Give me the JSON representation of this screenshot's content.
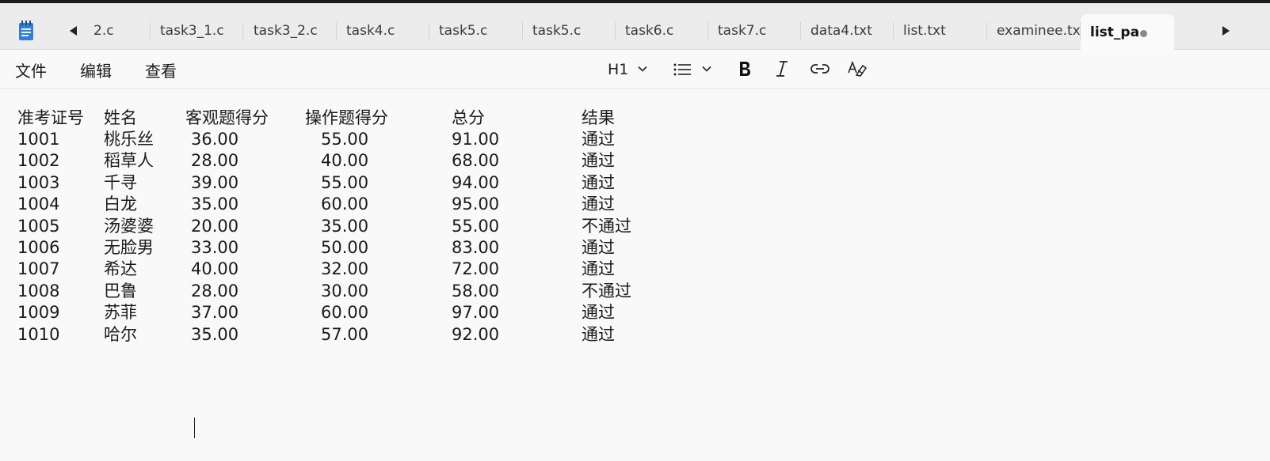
{
  "tabs": {
    "items": [
      {
        "label": "2.c"
      },
      {
        "label": "task3_1.c"
      },
      {
        "label": "task3_2.c"
      },
      {
        "label": "task4.c"
      },
      {
        "label": "task5.c"
      },
      {
        "label": "task5.c"
      },
      {
        "label": "task6.c"
      },
      {
        "label": "task7.c"
      },
      {
        "label": "data4.txt"
      },
      {
        "label": "list.txt"
      },
      {
        "label": "examinee.txt"
      },
      {
        "label": "list_pa"
      }
    ]
  },
  "menu": {
    "file": "文件",
    "edit": "编辑",
    "view": "查看"
  },
  "toolbar": {
    "heading_label": "H1"
  },
  "document": {
    "header": [
      "准考证号",
      "姓名",
      "客观题得分",
      "操作题得分",
      "总分",
      "结果"
    ],
    "rows": [
      [
        "1001",
        "桃乐丝",
        "36.00",
        "55.00",
        "91.00",
        "通过"
      ],
      [
        "1002",
        "稻草人",
        "28.00",
        "40.00",
        "68.00",
        "通过"
      ],
      [
        "1003",
        "千寻",
        "39.00",
        "55.00",
        "94.00",
        "通过"
      ],
      [
        "1004",
        "白龙",
        "35.00",
        "60.00",
        "95.00",
        "通过"
      ],
      [
        "1005",
        "汤婆婆",
        "20.00",
        "35.00",
        "55.00",
        "不通过"
      ],
      [
        "1006",
        "无脸男",
        "33.00",
        "50.00",
        "83.00",
        "通过"
      ],
      [
        "1007",
        "希达",
        "40.00",
        "32.00",
        "72.00",
        "通过"
      ],
      [
        "1008",
        "巴鲁",
        "28.00",
        "30.00",
        "58.00",
        "不通过"
      ],
      [
        "1009",
        "苏菲",
        "37.00",
        "60.00",
        "97.00",
        "通过"
      ],
      [
        "1010",
        "哈尔",
        "35.00",
        "57.00",
        "92.00",
        "通过"
      ]
    ]
  },
  "icons": {
    "app": "notepad-icon",
    "scroll_left": "caret-left-icon",
    "scroll_right": "caret-right-icon",
    "unsaved": "unsaved-dot-icon",
    "list": "bulleted-list-icon",
    "bold": "bold-icon",
    "italic": "italic-icon",
    "link": "link-icon",
    "clear_format": "clear-formatting-icon"
  },
  "colors": {
    "tabbar_bg": "#ececec",
    "active_tab_bg": "#fafafa",
    "editor_bg": "#f9f9f9",
    "app_icon": "#2f7fd6"
  }
}
